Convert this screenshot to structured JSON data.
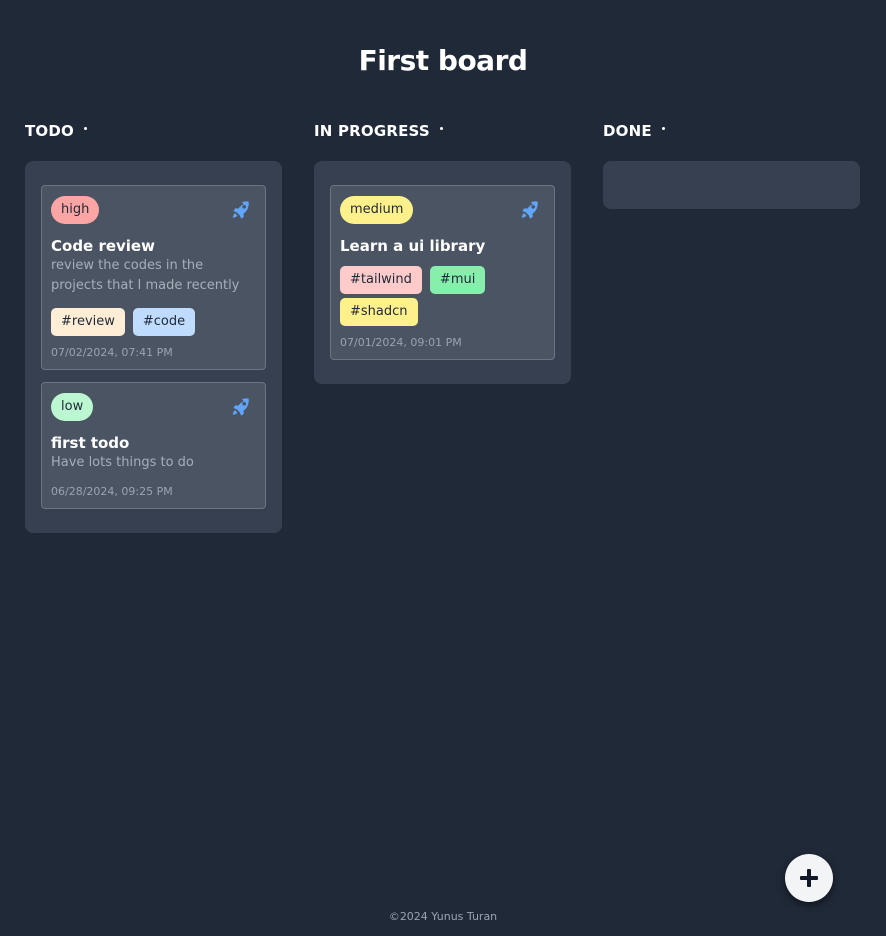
{
  "board": {
    "title": "First board"
  },
  "columns": [
    {
      "title": "TODO",
      "cards": [
        {
          "priority": "high",
          "priority_color": "#fca5a5",
          "title": "Code review",
          "description": "review the codes in the projects that I made recently",
          "tags": [
            {
              "label": "#review",
              "color": "#ffedd5"
            },
            {
              "label": "#code",
              "color": "#bfdbfe"
            }
          ],
          "date": "07/02/2024, 07:41 PM"
        },
        {
          "priority": "low",
          "priority_color": "#bbf7d0",
          "title": "first todo",
          "description": "Have lots things to do",
          "tags": [],
          "date": "06/28/2024, 09:25 PM"
        }
      ]
    },
    {
      "title": "IN PROGRESS",
      "cards": [
        {
          "priority": "medium",
          "priority_color": "#fef08a",
          "title": "Learn a ui library",
          "description": "",
          "tags": [
            {
              "label": "#tailwind",
              "color": "#fecaca"
            },
            {
              "label": "#mui",
              "color": "#86efac"
            },
            {
              "label": "#shadcn",
              "color": "#fef08a"
            }
          ],
          "date": "07/01/2024, 09:01 PM"
        }
      ]
    },
    {
      "title": "DONE",
      "cards": []
    }
  ],
  "icons": {
    "card_icon": "rocket-icon",
    "add_icon": "plus-icon",
    "accent": "#60a5fa"
  },
  "footer": {
    "text": "©2024 Yunus Turan"
  }
}
